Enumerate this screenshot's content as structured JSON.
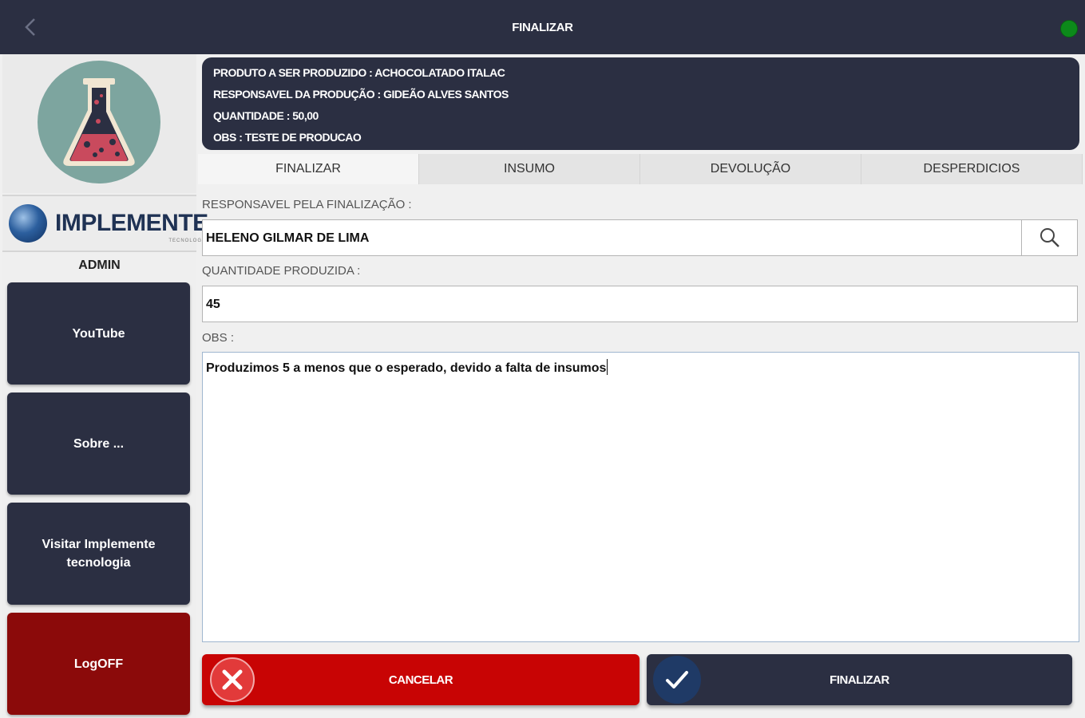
{
  "header": {
    "title": "FINALIZAR",
    "status_color": "#0c8a1a"
  },
  "sidebar": {
    "brand": "IMPLEMENTE",
    "brand_sub": "TECNOLOGIA",
    "user": "ADMIN",
    "buttons": [
      {
        "label": "YouTube"
      },
      {
        "label": "Sobre ..."
      },
      {
        "label": "Visitar Implemente tecnologia"
      },
      {
        "label": "LogOFF"
      }
    ]
  },
  "info": {
    "produto": "PRODUTO A SER PRODUZIDO : ACHOCOLATADO ITALAC",
    "responsavel": "RESPONSAVEL DA PRODUÇÃO : GIDEÃO ALVES SANTOS",
    "quantidade": "QUANTIDADE : 50,00",
    "obs": "OBS : TESTE DE PRODUCAO"
  },
  "tabs": [
    {
      "label": "FINALIZAR",
      "active": true
    },
    {
      "label": "INSUMO"
    },
    {
      "label": "DEVOLUÇÃO"
    },
    {
      "label": "DESPERDICIOS"
    }
  ],
  "form": {
    "responsavel_label": "RESPONSAVEL PELA FINALIZAÇÃO :",
    "responsavel_value": "HELENO GILMAR DE LIMA",
    "quantidade_label": "QUANTIDADE PRODUZIDA :",
    "quantidade_value": "45",
    "obs_label": "OBS :",
    "obs_value": "Produzimos 5 a menos que o esperado, devido a falta de insumos"
  },
  "actions": {
    "cancel_label": "CANCELAR",
    "finish_label": "FINALIZAR",
    "cancel_color": "#c80404",
    "finish_color": "#2b2f42"
  },
  "icons": [
    "back-arrow-icon",
    "flask-icon",
    "search-icon",
    "close-icon",
    "check-icon"
  ]
}
